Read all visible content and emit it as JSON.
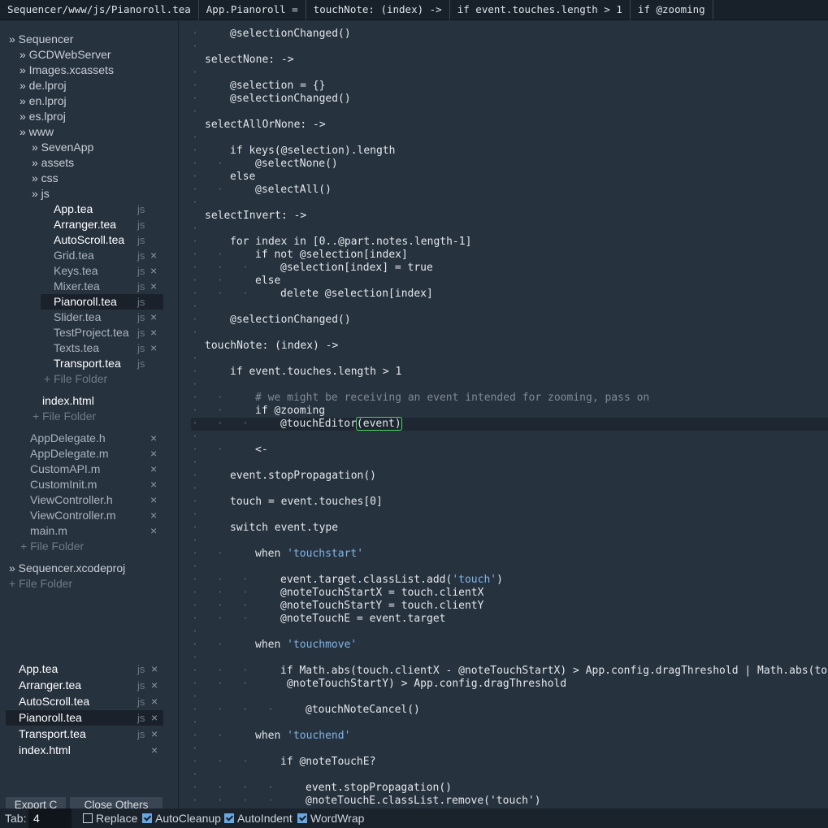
{
  "breadcrumb": [
    "Sequencer/www/js/Pianoroll.tea",
    "App.Pianoroll =",
    "touchNote: (index) ->",
    "if event.touches.length > 1",
    "if @zooming"
  ],
  "tree_icon": "double-chevron-right-icon",
  "tree": [
    {
      "label": "» Sequencer",
      "level": 0,
      "kind": "dir"
    },
    {
      "label": "» GCDWebServer",
      "level": 1,
      "kind": "dir"
    },
    {
      "label": "» Images.xcassets",
      "level": 1,
      "kind": "dir"
    },
    {
      "label": "» de.lproj",
      "level": 1,
      "kind": "dir"
    },
    {
      "label": "» en.lproj",
      "level": 1,
      "kind": "dir"
    },
    {
      "label": "» es.lproj",
      "level": 1,
      "kind": "dir"
    },
    {
      "label": "» www",
      "level": 1,
      "kind": "dir"
    },
    {
      "label": "» SevenApp",
      "level": 2,
      "kind": "dir"
    },
    {
      "label": "» assets",
      "level": 2,
      "kind": "dir"
    },
    {
      "label": "» css",
      "level": 2,
      "kind": "dir"
    },
    {
      "label": "» js",
      "level": 2,
      "kind": "dir"
    },
    {
      "label": "App.tea",
      "level": 3,
      "kind": "file-bright",
      "ext": "js",
      "close": false
    },
    {
      "label": "Arranger.tea",
      "level": 3,
      "kind": "file-bright",
      "ext": "js",
      "close": false
    },
    {
      "label": "AutoScroll.tea",
      "level": 3,
      "kind": "file-bright",
      "ext": "js",
      "close": false
    },
    {
      "label": "Grid.tea",
      "level": 3,
      "kind": "file-dim",
      "ext": "js",
      "close": true
    },
    {
      "label": "Keys.tea",
      "level": 3,
      "kind": "file-dim",
      "ext": "js",
      "close": true
    },
    {
      "label": "Mixer.tea",
      "level": 3,
      "kind": "file-dim",
      "ext": "js",
      "close": true
    },
    {
      "label": "Pianoroll.tea",
      "level": 3,
      "kind": "file-bright",
      "ext": "js",
      "close": false,
      "selected": true
    },
    {
      "label": "Slider.tea",
      "level": 3,
      "kind": "file-dim",
      "ext": "js",
      "close": true
    },
    {
      "label": "TestProject.tea",
      "level": 3,
      "kind": "file-dim",
      "ext": "js",
      "close": true
    },
    {
      "label": "Texts.tea",
      "level": 3,
      "kind": "file-dim",
      "ext": "js",
      "close": true
    },
    {
      "label": "Transport.tea",
      "level": 3,
      "kind": "file-bright",
      "ext": "js",
      "close": false
    },
    {
      "label": "+ File Folder",
      "level": 3,
      "kind": "add"
    },
    {
      "label": "index.html",
      "level": 2,
      "kind": "file-bright",
      "close": false,
      "gap": true
    },
    {
      "label": "+ File Folder",
      "level": 2,
      "kind": "add"
    },
    {
      "label": "AppDelegate.h",
      "level": 1,
      "kind": "file-dim",
      "close": true,
      "gap": true
    },
    {
      "label": "AppDelegate.m",
      "level": 1,
      "kind": "file-dim",
      "close": true
    },
    {
      "label": "CustomAPI.m",
      "level": 1,
      "kind": "file-dim",
      "close": true
    },
    {
      "label": "CustomInit.m",
      "level": 1,
      "kind": "file-dim",
      "close": true
    },
    {
      "label": "ViewController.h",
      "level": 1,
      "kind": "file-dim",
      "close": true
    },
    {
      "label": "ViewController.m",
      "level": 1,
      "kind": "file-dim",
      "close": true
    },
    {
      "label": "main.m",
      "level": 1,
      "kind": "file-dim",
      "close": true
    },
    {
      "label": "+ File Folder",
      "level": 1,
      "kind": "add"
    },
    {
      "label": "» Sequencer.xcodeproj",
      "level": 0,
      "kind": "dir",
      "gap": true
    },
    {
      "label": "+ File Folder",
      "level": 0,
      "kind": "add"
    }
  ],
  "open_files": [
    {
      "label": "App.tea",
      "ext": "js",
      "close": true
    },
    {
      "label": "Arranger.tea",
      "ext": "js",
      "close": true
    },
    {
      "label": "AutoScroll.tea",
      "ext": "js",
      "close": true
    },
    {
      "label": "Pianoroll.tea",
      "ext": "js",
      "close": true,
      "selected": true
    },
    {
      "label": "Transport.tea",
      "ext": "js",
      "close": true
    },
    {
      "label": "index.html",
      "close": true
    }
  ],
  "close_icon": "×",
  "buttons": {
    "export": "Export C",
    "close_others": "Close Others"
  },
  "guide_char": "·",
  "code_lines": [
    {
      "i": 1,
      "t": "@selectionChanged()"
    },
    {
      "i": -1,
      "t": ""
    },
    {
      "i": 0,
      "t": "selectNone: ->"
    },
    {
      "i": -1,
      "t": ""
    },
    {
      "i": 1,
      "t": "@selection = {}"
    },
    {
      "i": 1,
      "t": "@selectionChanged()"
    },
    {
      "i": -1,
      "t": ""
    },
    {
      "i": 0,
      "t": "selectAllOrNone: ->"
    },
    {
      "i": -1,
      "t": ""
    },
    {
      "i": 1,
      "t": "if keys(@selection).length"
    },
    {
      "i": 2,
      "t": "@selectNone()"
    },
    {
      "i": 1,
      "t": "else"
    },
    {
      "i": 2,
      "t": "@selectAll()"
    },
    {
      "i": -1,
      "t": ""
    },
    {
      "i": 0,
      "t": "selectInvert: ->"
    },
    {
      "i": -1,
      "t": ""
    },
    {
      "i": 1,
      "t": "for index in [0..@part.notes.length-1]"
    },
    {
      "i": 2,
      "t": "if not @selection[index]"
    },
    {
      "i": 3,
      "t": "@selection[index] = true"
    },
    {
      "i": 2,
      "t": "else"
    },
    {
      "i": 3,
      "t": "delete @selection[index]"
    },
    {
      "i": -1,
      "t": ""
    },
    {
      "i": 1,
      "t": "@selectionChanged()"
    },
    {
      "i": -1,
      "t": ""
    },
    {
      "i": 0,
      "t": "touchNote: (index) ->"
    },
    {
      "i": -1,
      "t": ""
    },
    {
      "i": 1,
      "t": "if event.touches.length > 1"
    },
    {
      "i": -1,
      "t": ""
    },
    {
      "i": 2,
      "t": "# we might be receiving an event intended for zooming, pass on",
      "c": true
    },
    {
      "i": 2,
      "t": "if @zooming"
    },
    {
      "i": 3,
      "t": "@touchEditor",
      "h": "(event)",
      "cur": true
    },
    {
      "i": -1,
      "t": ""
    },
    {
      "i": 2,
      "t": "<-"
    },
    {
      "i": -1,
      "t": ""
    },
    {
      "i": 1,
      "t": "event.stopPropagation()"
    },
    {
      "i": -1,
      "t": ""
    },
    {
      "i": 1,
      "t": "touch = event.touches[0]"
    },
    {
      "i": -1,
      "t": ""
    },
    {
      "i": 1,
      "t": "switch event.type"
    },
    {
      "i": -1,
      "t": ""
    },
    {
      "i": 2,
      "t": "when ",
      "s": "'touchstart'"
    },
    {
      "i": -1,
      "t": ""
    },
    {
      "i": 3,
      "t": "event.target.classList.add(",
      "s": "'touch'",
      "a": ")"
    },
    {
      "i": 3,
      "t": "@noteTouchStartX = touch.clientX"
    },
    {
      "i": 3,
      "t": "@noteTouchStartY = touch.clientY"
    },
    {
      "i": 3,
      "t": "@noteTouchE = event.target"
    },
    {
      "i": -1,
      "t": ""
    },
    {
      "i": 2,
      "t": "when ",
      "s": "'touchmove'"
    },
    {
      "i": -1,
      "t": ""
    },
    {
      "i": 3,
      "t": "if Math.abs(touch.clientX - @noteTouchStartX) > App.config.dragThreshold | Math.abs(touch.clientY -"
    },
    {
      "i": -3,
      "t": " @noteTouchStartY) > App.config.dragThreshold"
    },
    {
      "i": -1,
      "t": ""
    },
    {
      "i": 4,
      "t": "@touchNoteCancel()"
    },
    {
      "i": -1,
      "t": ""
    },
    {
      "i": 2,
      "t": "when ",
      "s": "'touchend'"
    },
    {
      "i": -1,
      "t": ""
    },
    {
      "i": 3,
      "t": "if @noteTouchE?"
    },
    {
      "i": -1,
      "t": ""
    },
    {
      "i": 4,
      "t": "event.stopPropagation()"
    },
    {
      "i": 4,
      "t": "@noteTouchE.classList.remove('touch')"
    }
  ],
  "status": {
    "tab_label": "Tab:",
    "tab_value": "4",
    "options": [
      {
        "label": "Replace",
        "checked": false
      },
      {
        "label": "AutoCleanup",
        "checked": true
      },
      {
        "label": "AutoIndent",
        "checked": true
      },
      {
        "label": "WordWrap",
        "checked": true
      }
    ]
  }
}
